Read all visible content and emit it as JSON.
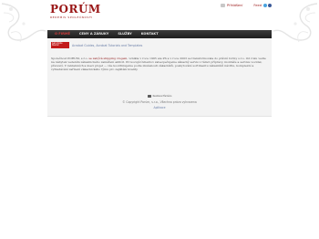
{
  "header": {
    "logo_main": "PORÚM",
    "logo_sub": "REDEMIS SPOLEČNOSTI",
    "link_login": "Přihlášení",
    "link_feed": "Feed"
  },
  "nav": {
    "items": [
      {
        "label": "O FIRMĚ",
        "active": true
      },
      {
        "label": "CENY A ZÁRUKY",
        "active": false
      },
      {
        "label": "SLUŽBY",
        "active": false
      },
      {
        "label": "KONTAKT",
        "active": false
      }
    ]
  },
  "content": {
    "acrobat_badge": "Get Adobe Reader",
    "acrobat_links": "Acrobat Guides, Acrobat Tutorials and Templates",
    "para_start": "Společnost PORÚM, s.r.o.",
    "para_accent": " se zabývá shipping vlogem",
    "para_rest": ", vznikla v roce 1995 ale PS a v roce 2003 se transformovala do právní formy s.r.o. Od roku vedle na nábytek vedením zákaznického zaměření aktivit. Provozující klientov zabezpečujeme zákazný servis v rámci přípravy, montáže a servisu vozidel, převzetí, V reklamních a mezi projet — vše koordinujeme podle zkušenosti zákazníků, poskytování sortimentu zákazníků návrhu, komplexní a vyhledávání zařízení zákaznického týmu pro zajištění kvality."
  },
  "footer": {
    "logo_text": "Realizace Přeměna",
    "copyright": "© Copyright Porúm, s.r.o., Všechna práva vyhrazena",
    "link": "Aplikace"
  },
  "colors": {
    "brand": "#9a1717",
    "nav_bg": "#2a2a2a",
    "link": "#6b7fa8"
  }
}
